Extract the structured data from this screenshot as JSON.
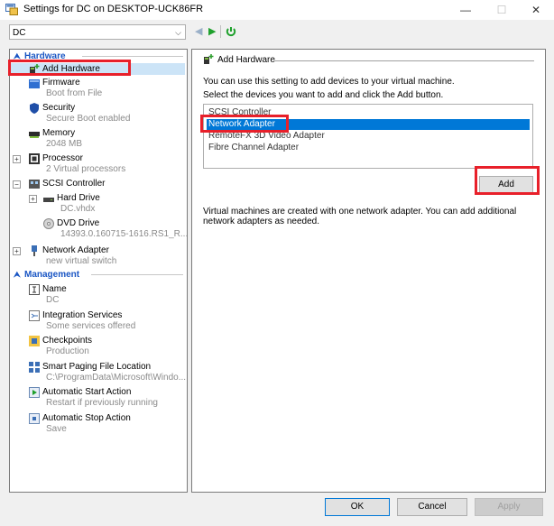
{
  "window": {
    "title": "Settings for DC on DESKTOP-UCK86FR",
    "minimize": "—",
    "maximize": "☐",
    "close": "✕"
  },
  "vm_select": {
    "value": "DC"
  },
  "sidebar": {
    "hardware_header": "Hardware",
    "management_header": "Management",
    "items": [
      {
        "name": "Add Hardware",
        "sub": ""
      },
      {
        "name": "Firmware",
        "sub": "Boot from File"
      },
      {
        "name": "Security",
        "sub": "Secure Boot enabled"
      },
      {
        "name": "Memory",
        "sub": "2048 MB"
      },
      {
        "name": "Processor",
        "sub": "2 Virtual processors"
      },
      {
        "name": "SCSI Controller",
        "sub": ""
      },
      {
        "name": "Hard Drive",
        "sub": "DC.vhdx"
      },
      {
        "name": "DVD Drive",
        "sub": "14393.0.160715-1616.RS1_R..."
      },
      {
        "name": "Network Adapter",
        "sub": "new virtual switch"
      }
    ],
    "mgmt_items": [
      {
        "name": "Name",
        "sub": "DC"
      },
      {
        "name": "Integration Services",
        "sub": "Some services offered"
      },
      {
        "name": "Checkpoints",
        "sub": "Production"
      },
      {
        "name": "Smart Paging File Location",
        "sub": "C:\\ProgramData\\Microsoft\\Windo..."
      },
      {
        "name": "Automatic Start Action",
        "sub": "Restart if previously running"
      },
      {
        "name": "Automatic Stop Action",
        "sub": "Save"
      }
    ]
  },
  "main": {
    "group_title": "Add Hardware",
    "desc1": "You can use this setting to add devices to your virtual machine.",
    "desc2": "Select the devices you want to add and click the Add button.",
    "devices": [
      "SCSI Controller",
      "Network Adapter",
      "RemoteFX 3D Video Adapter",
      "Fibre Channel Adapter"
    ],
    "add_label": "Add",
    "note": "Virtual machines are created with one network adapter. You can add additional network adapters as needed."
  },
  "footer": {
    "ok": "OK",
    "cancel": "Cancel",
    "apply": "Apply"
  },
  "colors": {
    "accent": "#1a56c4",
    "selection": "#0078d7",
    "highlight": "#e8202a"
  }
}
